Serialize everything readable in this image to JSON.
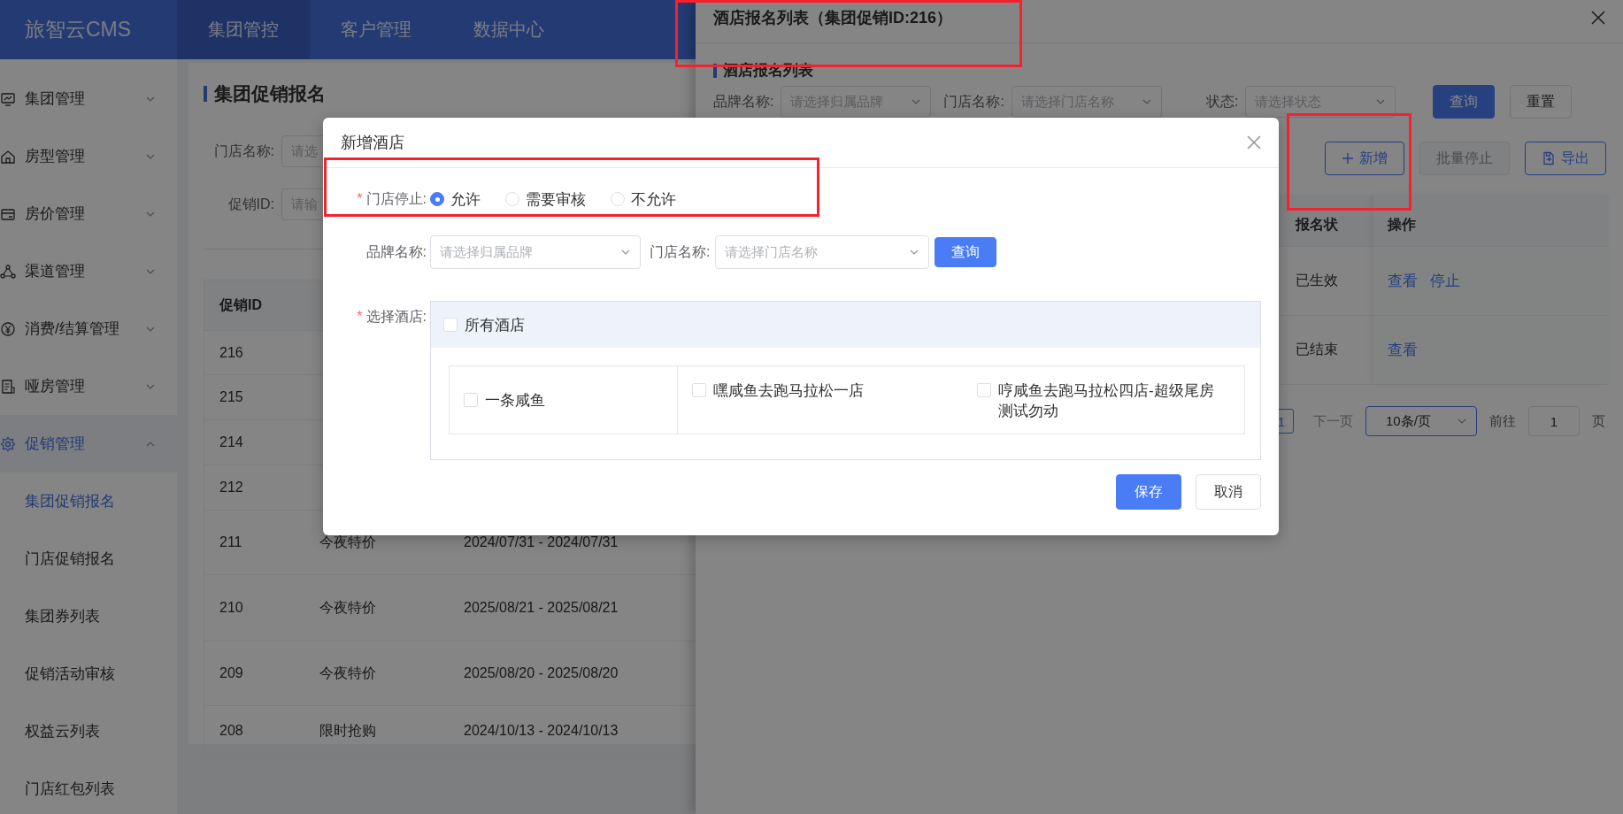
{
  "app": {
    "logo": "旅智云CMS",
    "nav": [
      {
        "label": "集团管控",
        "selected": true
      },
      {
        "label": "客户管理",
        "selected": false
      },
      {
        "label": "数据中心",
        "selected": false
      }
    ]
  },
  "sidebar": {
    "items": [
      {
        "label": "集团管理",
        "expanded": false,
        "selected": false
      },
      {
        "label": "房型管理",
        "expanded": false,
        "selected": false
      },
      {
        "label": "房价管理",
        "expanded": false,
        "selected": false
      },
      {
        "label": "渠道管理",
        "expanded": false,
        "selected": false
      },
      {
        "label": "消费/结算管理",
        "expanded": false,
        "selected": false
      },
      {
        "label": "哑房管理",
        "expanded": false,
        "selected": false
      },
      {
        "label": "促销管理",
        "expanded": true,
        "selected": true,
        "children": [
          {
            "label": "集团促销报名",
            "selected": true
          },
          {
            "label": "门店促销报名",
            "selected": false
          },
          {
            "label": "集团券列表",
            "selected": false
          },
          {
            "label": "促销活动审核",
            "selected": false
          },
          {
            "label": "权益云列表",
            "selected": false
          },
          {
            "label": "门店红包列表",
            "selected": false
          }
        ]
      }
    ]
  },
  "page": {
    "title": "集团促销报名",
    "filters": [
      {
        "label": "门店名称:",
        "placeholder": "请选"
      },
      {
        "label": "促销ID:",
        "placeholder": "请输"
      }
    ],
    "table": {
      "columns": [
        "促销ID"
      ],
      "rows": [
        {
          "cells": [
            "216"
          ]
        },
        {
          "cells": [
            "215"
          ]
        },
        {
          "cells": [
            "214"
          ]
        },
        {
          "cells": [
            "212"
          ]
        },
        {
          "cells": [
            "211",
            "今夜特价",
            "2024/07/31 - 2024/07/31"
          ]
        },
        {
          "cells": [
            "210",
            "今夜特价",
            "2025/08/21 - 2025/08/21"
          ]
        },
        {
          "cells": [
            "209",
            "今夜特价",
            "2025/08/20 - 2025/08/20"
          ]
        },
        {
          "cells": [
            "208",
            "限时抢购",
            "2024/10/13 - 2024/10/13"
          ]
        }
      ]
    }
  },
  "drawer": {
    "title": "酒店报名列表（集团促销ID:216）",
    "section": "酒店报名列表",
    "filters": [
      {
        "label": "品牌名称:",
        "placeholder": "请选择归属品牌"
      },
      {
        "label": "门店名称:",
        "placeholder": "请选择门店名称"
      },
      {
        "label": "状态:",
        "placeholder": "请选择状态"
      }
    ],
    "buttons": [
      {
        "label": "查询",
        "kind": "primary"
      },
      {
        "label": "重置",
        "kind": "default"
      }
    ],
    "actions": [
      {
        "label": "新增",
        "kind": "add",
        "disabled": false
      },
      {
        "label": "批量停止",
        "kind": "plain",
        "disabled": true
      },
      {
        "label": "导出",
        "kind": "export",
        "disabled": false
      }
    ],
    "table": {
      "columns": [
        "报名状",
        "操作"
      ],
      "rows": [
        {
          "status": "已生效",
          "links": [
            "查看",
            "停止"
          ]
        },
        {
          "status": "已结束",
          "links": [
            "查看"
          ]
        }
      ]
    },
    "pagination": {
      "page": "1",
      "next": "下一页",
      "page_size": "10条/页",
      "goto": "前往",
      "goto_value": "1",
      "suffix": "页"
    }
  },
  "modal": {
    "title": "新增酒店",
    "stop_policy": {
      "mark": "*",
      "label": "门店停止:",
      "options": [
        {
          "label": "允许",
          "selected": true
        },
        {
          "label": "需要审核",
          "selected": false
        },
        {
          "label": "不允许",
          "selected": false
        }
      ]
    },
    "filters": [
      {
        "label": "品牌名称:",
        "placeholder": "请选择归属品牌"
      },
      {
        "label": "门店名称:",
        "placeholder": "请选择门店名称"
      }
    ],
    "query_button": "查询",
    "hotel_select": {
      "mark": "*",
      "label": "选择酒店:",
      "all": {
        "label": "所有酒店",
        "checked": false
      },
      "hotels": [
        {
          "label": "一条咸鱼",
          "checked": false
        },
        {
          "label": "嘿咸鱼去跑马拉松一店",
          "checked": false
        },
        {
          "label": "哼咸鱼去跑马拉松四店-超级尾房测试勿动",
          "checked": false
        }
      ]
    },
    "buttons": [
      {
        "label": "保存",
        "kind": "primary"
      },
      {
        "label": "取消",
        "kind": "default"
      }
    ]
  }
}
